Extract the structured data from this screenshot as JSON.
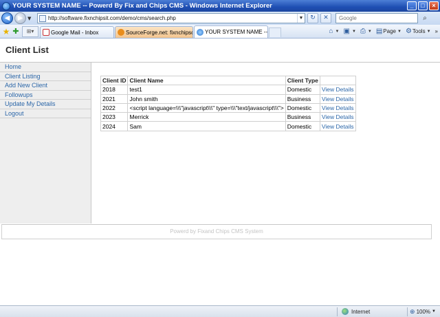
{
  "window": {
    "title": "YOUR SYSTEM NAME -- Powerd By Fix and Chips CMS - Windows Internet Explorer",
    "minimize": "_",
    "maximize": "□",
    "close": "×"
  },
  "address_bar": {
    "url": "http://software.fixnchipsit.com/demo/cms/search.php",
    "search_placeholder": "Google"
  },
  "tabs": [
    {
      "label": "Google Mail - Inbox"
    },
    {
      "label": "SourceForge.net: fixnchipsc..."
    },
    {
      "label": "YOUR SYSTEM NAME -- P...",
      "active": true
    }
  ],
  "commands": {
    "page": "Page",
    "tools": "Tools"
  },
  "page": {
    "title": "Client List",
    "nav": [
      "Home",
      "Client Listing",
      "Add New Client",
      "Followups",
      "Update My Details",
      "Logout"
    ],
    "table": {
      "headers": [
        "Client ID",
        "Client Name",
        "Client Type"
      ],
      "rows": [
        {
          "id": "2018",
          "name": "test1",
          "type": "Domestic",
          "action": "View Details"
        },
        {
          "id": "2021",
          "name": "John smith",
          "type": "Business",
          "action": "View Details"
        },
        {
          "id": "2022",
          "name": "<script language=\\\\\\\"javascript\\\\\\\" type=\\\\\\\"text/javascript\\\\\\\">",
          "type": "Domestic",
          "action": "View Details"
        },
        {
          "id": "2023",
          "name": "Merrick",
          "type": "Business",
          "action": "View Details"
        },
        {
          "id": "2024",
          "name": "Sam",
          "type": "Domestic",
          "action": "View Details"
        }
      ]
    },
    "footer": "Powerd by Fixand Chips CMS System"
  },
  "status_bar": {
    "zone": "Internet",
    "zoom": "100%"
  },
  "colors": {
    "link": "#2b66a8",
    "sidebar_bg": "#eeeeee",
    "titlebar": "#1f4fb3"
  }
}
